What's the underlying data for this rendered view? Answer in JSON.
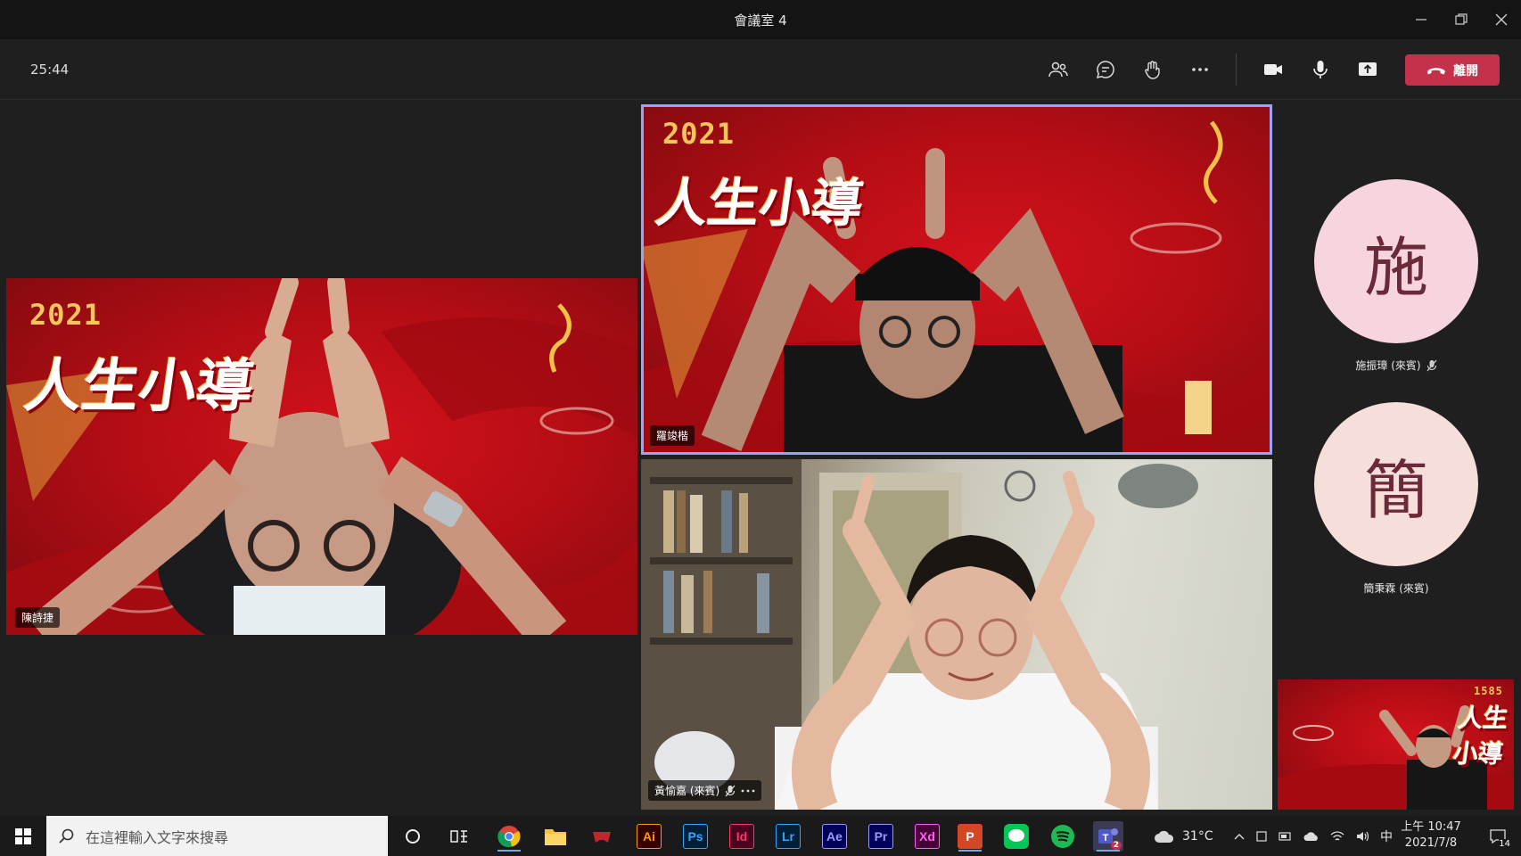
{
  "window": {
    "title": "會議室 4"
  },
  "toolbar": {
    "timer": "25:44",
    "leave_label": "離開"
  },
  "participants": {
    "left": {
      "name": "陳詩捷"
    },
    "top": {
      "name": "羅竣楷"
    },
    "bottom": {
      "name": "黃愉嘉 (來賓)"
    },
    "avatar_1": {
      "initial": "施",
      "name": "施振璋 (來賓)"
    },
    "avatar_2": {
      "initial": "簡",
      "name": "簡秉霖 (來賓)"
    }
  },
  "banner": {
    "year": "2021",
    "title": "人生小導"
  },
  "self_view": {
    "banner_text": "1585"
  },
  "taskbar": {
    "search_placeholder": "在這裡輸入文字來搜尋",
    "apps": [
      {
        "label": "Ai",
        "color": "#ff9a00",
        "bg": "#330000"
      },
      {
        "label": "Ps",
        "color": "#31a8ff",
        "bg": "#001e36"
      },
      {
        "label": "Id",
        "color": "#ff3366",
        "bg": "#49021f"
      },
      {
        "label": "Lr",
        "color": "#31a8ff",
        "bg": "#001e36"
      },
      {
        "label": "Ae",
        "color": "#9999ff",
        "bg": "#00005b"
      },
      {
        "label": "Pr",
        "color": "#9999ff",
        "bg": "#00005b"
      },
      {
        "label": "Xd",
        "color": "#ff61f6",
        "bg": "#470137"
      }
    ],
    "weather": "31°C",
    "ime": "中",
    "time": "上午 10:47",
    "date": "2021/7/8",
    "notifications": "14",
    "teams_badge": "2"
  }
}
